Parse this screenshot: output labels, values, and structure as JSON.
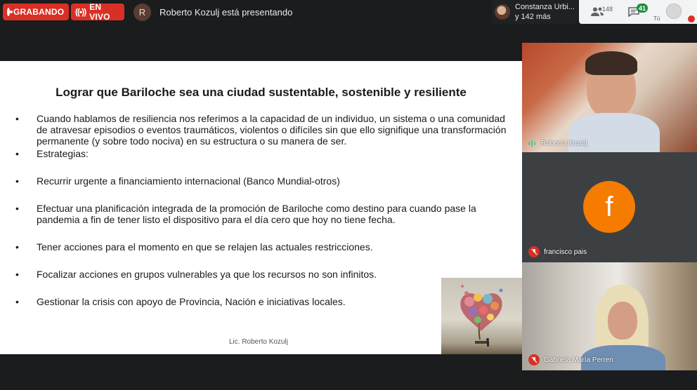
{
  "topbar": {
    "recording_label": "GRABANDO",
    "live_label": "EN VIVO",
    "presenter_initial": "R",
    "presenting_text": "Roberto Kozulj está presentando",
    "participant_name": "Constanza Urbi...",
    "participant_more": "y 142 más",
    "people_count": "148",
    "chat_count": "41",
    "you_label": "Tú"
  },
  "slide": {
    "title": "Lograr que Bariloche sea una ciudad sustentable, sostenible y resiliente",
    "bullets": [
      "Cuando hablamos de resiliencia nos referimos a la capacidad de un individuo, un sistema o una comunidad de atravesar episodios o eventos traumáticos, violentos o difíciles sin que ello signifique una transformación permanente (y sobre todo nociva) en su estructura o su manera de ser.",
      "Estrategias:",
      "Recurrir urgente a financiamiento internacional (Banco Mundial-otros)",
      "Efectuar una planificación integrada de la promoción de Bariloche como destino para cuando pase la pandemia a fin de tener listo el dispositivo para el día cero que hoy no tiene fecha.",
      "Tener acciones para el momento en que se relajen las actuales restricciones.",
      "Focalizar acciones en grupos vulnerables ya que los recursos no son infinitos.",
      "Gestionar la crisis con apoyo de Provincia, Nación e iniciativas locales."
    ],
    "footer": "Lic. Roberto Kozulj"
  },
  "tiles": [
    {
      "name": "Roberto Kozulj",
      "state": "speaking"
    },
    {
      "name": "francisco pais",
      "state": "muted",
      "initial": "f"
    },
    {
      "name": "Gabriela María Perren",
      "state": "muted"
    }
  ],
  "colors": {
    "recording_red": "#d93025",
    "speaking_green": "#34d399",
    "avatar_orange": "#f57c00",
    "chat_badge_green": "#1e8e3e"
  }
}
